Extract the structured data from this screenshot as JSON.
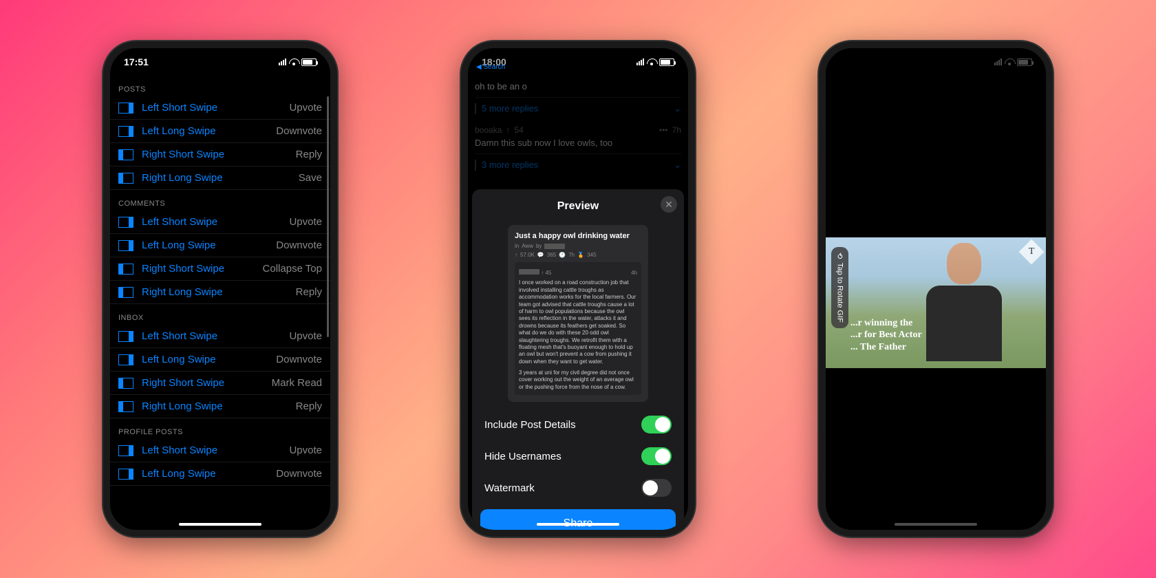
{
  "phone1": {
    "time": "17:51",
    "sections": [
      {
        "header": "POSTS",
        "rows": [
          {
            "icon": "left",
            "label": "Left Short Swipe",
            "value": "Upvote"
          },
          {
            "icon": "left",
            "label": "Left Long Swipe",
            "value": "Downvote"
          },
          {
            "icon": "right",
            "label": "Right Short Swipe",
            "value": "Reply"
          },
          {
            "icon": "right",
            "label": "Right Long Swipe",
            "value": "Save"
          }
        ]
      },
      {
        "header": "COMMENTS",
        "rows": [
          {
            "icon": "left",
            "label": "Left Short Swipe",
            "value": "Upvote"
          },
          {
            "icon": "left",
            "label": "Left Long Swipe",
            "value": "Downvote"
          },
          {
            "icon": "right",
            "label": "Right Short Swipe",
            "value": "Collapse Top"
          },
          {
            "icon": "right",
            "label": "Right Long Swipe",
            "value": "Reply"
          }
        ]
      },
      {
        "header": "INBOX",
        "rows": [
          {
            "icon": "left",
            "label": "Left Short Swipe",
            "value": "Upvote"
          },
          {
            "icon": "left",
            "label": "Left Long Swipe",
            "value": "Downvote"
          },
          {
            "icon": "right",
            "label": "Right Short Swipe",
            "value": "Mark Read"
          },
          {
            "icon": "right",
            "label": "Right Long Swipe",
            "value": "Reply"
          }
        ]
      },
      {
        "header": "PROFILE POSTS",
        "rows": [
          {
            "icon": "left",
            "label": "Left Short Swipe",
            "value": "Upvote"
          },
          {
            "icon": "left",
            "label": "Left Long Swipe",
            "value": "Downvote"
          }
        ]
      }
    ]
  },
  "phone2": {
    "time": "18:00",
    "back": "Search",
    "bg_title_fragment": "oh to be an o",
    "replies1": "5 more replies",
    "comment_user": "booaka",
    "comment_score": "54",
    "comment_age": "7h",
    "comment_text": "Damn this sub now I love owls, too",
    "replies2": "3 more replies",
    "modal_title": "Preview",
    "preview": {
      "title": "Just a happy owl drinking water",
      "sub_prefix": "in",
      "sub": "Aww",
      "by": "by",
      "upvotes": "57.0K",
      "comments": "365",
      "age": "7h",
      "awards": "345",
      "c_score": "45",
      "c_age": "4h",
      "body1": "I once worked on a road construction job that involved installing cattle troughs as accommodation works for the local farmers. Our team got advised that cattle troughs cause a lot of harm to owl populations because the owl sees its reflection in the water, attacks it and drowns because its feathers get soaked. So what do we do with these 20 odd owl slaughtering troughs. We retrofit them with a floating mesh that's buoyant enough to hold up an owl but won't prevent a cow from pushing it down when they want to get water.",
      "body2": "3 years at uni for my civil degree did not once cover working out the weight of an average owl or the pushing force from the nose of a cow."
    },
    "toggles": [
      {
        "label": "Include Post Details",
        "on": true
      },
      {
        "label": "Hide Usernames",
        "on": true
      },
      {
        "label": "Watermark",
        "on": false
      }
    ],
    "share": "Share"
  },
  "phone3": {
    "rotate_label": "Tap to Rotate GIF",
    "badge_letter": "T",
    "caption_line1": "...r winning the",
    "caption_line2": "...r for Best Actor",
    "caption_line3": "... The Father"
  }
}
